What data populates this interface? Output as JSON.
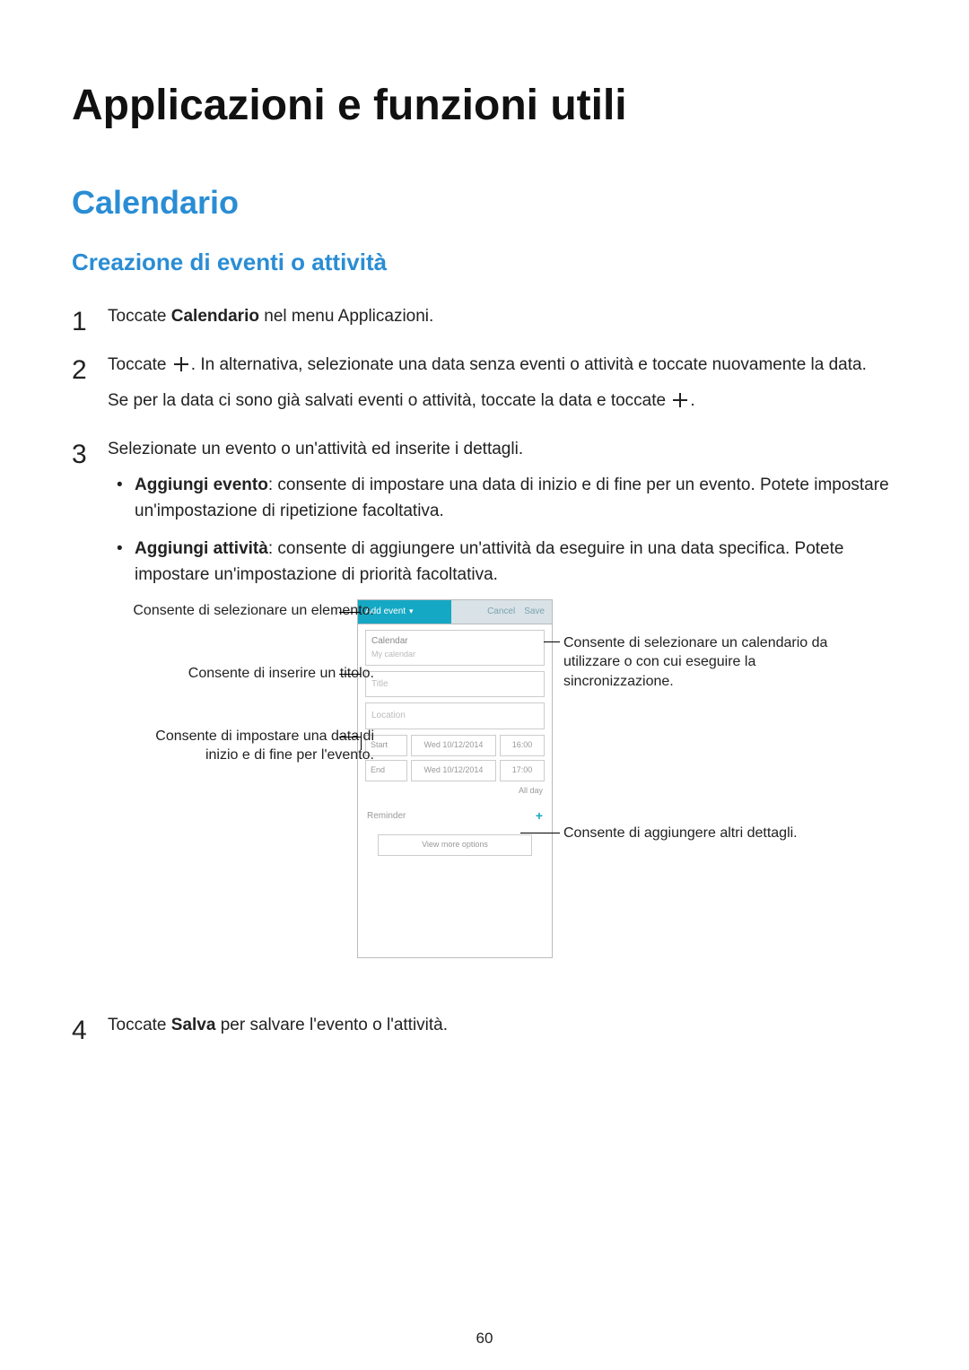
{
  "page_number": "60",
  "h1": "Applicazioni e funzioni utili",
  "h2": "Calendario",
  "h3": "Creazione di eventi o attività",
  "steps": {
    "s1_pre": "Toccate ",
    "s1_b": "Calendario",
    "s1_post": " nel menu Applicazioni.",
    "s2_pre": "Toccate ",
    "s2_post": ". In alternativa, selezionate una data senza eventi o attività e toccate nuovamente la data.",
    "s2_p2_pre": "Se per la data ci sono già salvati eventi o attività, toccate la data e toccate ",
    "s2_p2_post": ".",
    "s3": "Selezionate un evento o un'attività ed inserite i dettagli.",
    "s3_b1_b": "Aggiungi evento",
    "s3_b1_rest": ": consente di impostare una data di inizio e di fine per un evento. Potete impostare un'impostazione di ripetizione facoltativa.",
    "s3_b2_b": "Aggiungi attività",
    "s3_b2_rest": ": consente di aggiungere un'attività da eseguire in una data specifica. Potete impostare un'impostazione di priorità facoltativa.",
    "s4_pre": "Toccate ",
    "s4_b": "Salva",
    "s4_post": " per salvare l'evento o l'attività."
  },
  "callouts": {
    "left1": "Consente di selezionare un elemento.",
    "left2": "Consente di inserire un titolo.",
    "left3": "Consente di impostare una data di inizio e di fine per l'evento.",
    "right1": "Consente di selezionare un calendario da utilizzare o con cui eseguire la sincronizzazione.",
    "right2": "Consente di aggiungere altri dettagli."
  },
  "mock": {
    "tab_add": "Add event",
    "tab_cancel": "Cancel",
    "tab_save": "Save",
    "cal_label": "Calendar",
    "cal_sub": "My calendar",
    "title_ph": "Title",
    "location_ph": "Location",
    "start_label": "Start",
    "end_label": "End",
    "date1": "Wed 10/12/2014",
    "time1": "16:00",
    "date2": "Wed 10/12/2014",
    "time2": "17:00",
    "all_day": "All day",
    "reminder": "Reminder",
    "view_more": "View more options"
  }
}
